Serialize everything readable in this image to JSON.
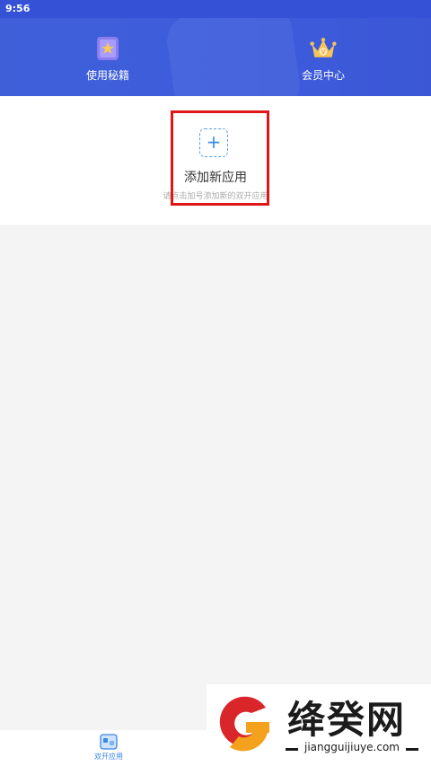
{
  "status_bar": {
    "time": "9:56"
  },
  "header": {
    "features": [
      {
        "label": "使用秘籍",
        "icon": "book-star-icon"
      },
      {
        "label": "会员中心",
        "icon": "crown-icon"
      }
    ]
  },
  "add_app": {
    "icon": "plus-icon",
    "plus_symbol": "+",
    "title": "添加新应用",
    "hint": "请点击加号添加新的双开应用"
  },
  "bottom_nav": {
    "items": [
      {
        "label": "双开应用",
        "icon": "dual-app-icon",
        "active": true
      }
    ]
  },
  "watermark": {
    "name": "绛癸网",
    "url": "jiangguijiuye.com"
  },
  "colors": {
    "header_blue": "#3d5cdc",
    "highlight_red": "#e11616",
    "accent_blue": "#3a86e8",
    "background_gray": "#f4f4f4"
  }
}
